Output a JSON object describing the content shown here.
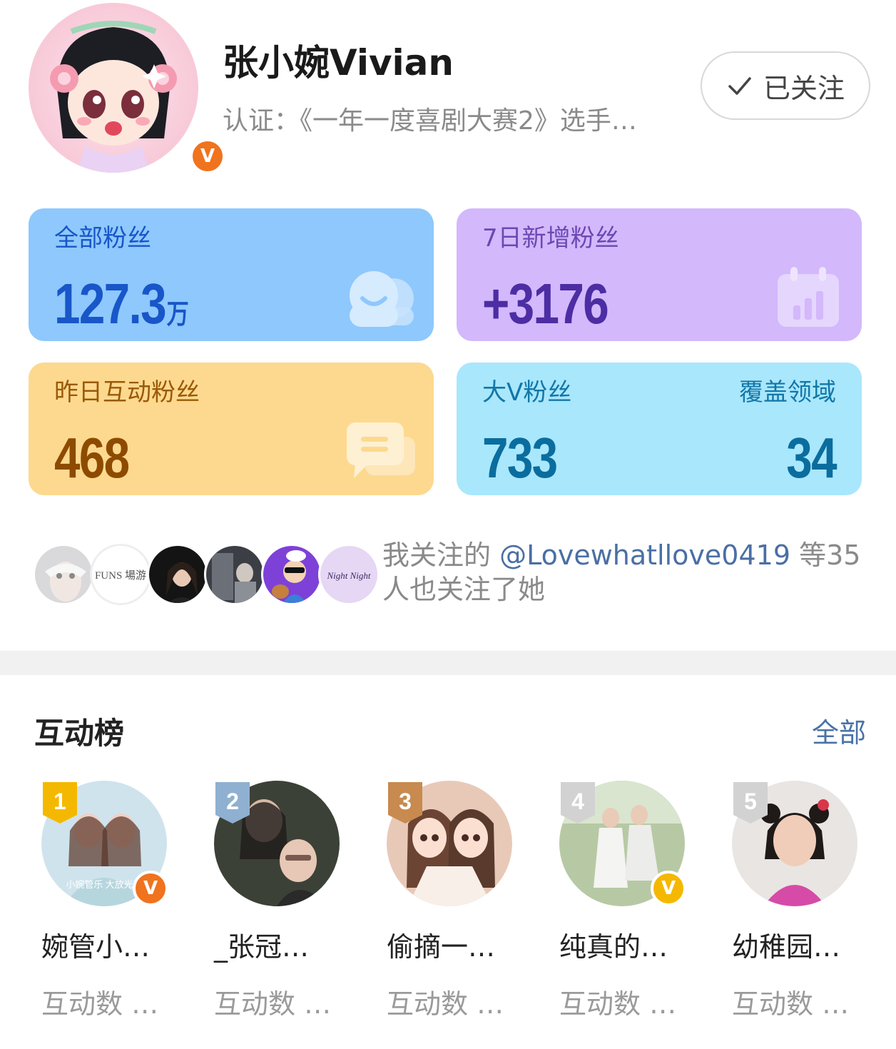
{
  "profile": {
    "name": "张小婉Vivian",
    "verification": "认证：《一年一度喜剧大赛2》选手…",
    "follow_label": "已关注",
    "avatar_badge": "V"
  },
  "stats": {
    "all_fans": {
      "label": "全部粉丝",
      "value": "127.3",
      "unit": "万"
    },
    "new_fans_7d": {
      "label": "7日新增粉丝",
      "value": "+3176"
    },
    "interactive_fans_yesterday": {
      "label": "昨日互动粉丝",
      "value": "468"
    },
    "big_v_fans": {
      "label": "大V粉丝",
      "value": "733",
      "domain_label": "覆盖领域",
      "domain_value": "34"
    }
  },
  "mutual": {
    "prefix": "我关注的 ",
    "user": "@Lovewhatllove0419",
    "suffix": " 等35人也关注了她",
    "avatar_texts": [
      "FUNS 場游",
      "Night Night"
    ]
  },
  "ranking": {
    "title": "互动榜",
    "all_link": "全部",
    "items": [
      {
        "rank": "1",
        "name": "婉管小…",
        "count": "互动数 …",
        "avatar_text": "小婉管乐 大放光彩",
        "badge": "V"
      },
      {
        "rank": "2",
        "name": "_张冠…",
        "count": "互动数 …"
      },
      {
        "rank": "3",
        "name": "偷摘一…",
        "count": "互动数 …"
      },
      {
        "rank": "4",
        "name": "纯真的…",
        "count": "互动数 …",
        "badge": "V"
      },
      {
        "rank": "5",
        "name": "幼稚园…",
        "count": "互动数 …"
      }
    ]
  },
  "colors": {
    "all_fans_card": "#8ec8fd",
    "new_fans_card": "#d3b8fc",
    "interactive_card": "#fdd98f",
    "big_v_card": "#a9e7fc",
    "orange_badge": "#f0731e",
    "gold_badge": "#f5b800",
    "link_blue": "#4a72a8"
  },
  "icons": [
    "check-icon",
    "fans-icon",
    "calendar-chart-icon",
    "chat-bubble-icon",
    "v-verified-icon",
    "rank-medal-icon"
  ]
}
